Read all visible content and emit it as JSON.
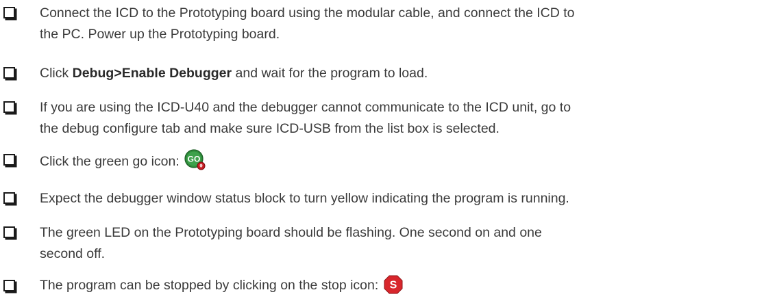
{
  "items": [
    {
      "line1": "Connect the ICD to the Prototyping board using the modular cable, and connect the ICD to",
      "line2": "the PC. Power up the Prototyping board."
    },
    {
      "pre": "Click ",
      "bold": "Debug>Enable Debugger",
      "post": " and wait for the program to load."
    },
    {
      "line1": "If you are using the ICD-U40 and the debugger cannot communicate to the ICD unit, go to",
      "line2": "the debug configure tab and make sure ICD-USB from the list box is selected."
    },
    {
      "text": "Click the green go icon:",
      "icon_label": "GO",
      "icon": "go-icon"
    },
    {
      "text": "Expect the debugger window status block to turn yellow indicating the program is running."
    },
    {
      "line1": "The green LED on the Prototyping board should be flashing. One second on and one",
      "line2": "second off."
    },
    {
      "text": "The program can be stopped by clicking on the stop icon:",
      "icon_label": "S",
      "icon": "stop-icon"
    }
  ],
  "colors": {
    "text": "#3a3a3a",
    "go_icon_green": "#2e8b3a",
    "stop_icon_red": "#d8262c"
  }
}
